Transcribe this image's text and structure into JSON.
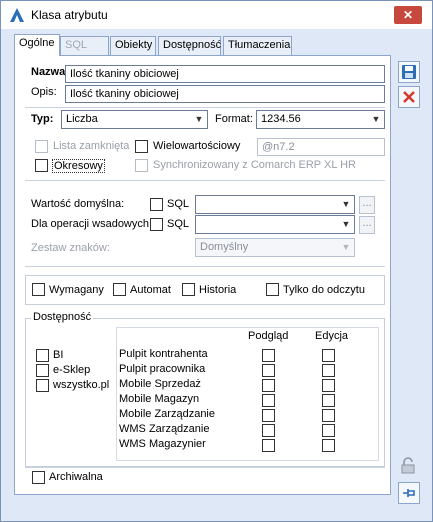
{
  "window": {
    "title": "Klasa atrybutu",
    "close_glyph": "✕"
  },
  "tabs": [
    {
      "label": "Ogólne",
      "active": true
    },
    {
      "label": "SQL",
      "disabled": true
    },
    {
      "label": "Obiekty"
    },
    {
      "label": "Dostępność"
    },
    {
      "label": "Tłumaczenia"
    }
  ],
  "form": {
    "name_label": "Nazwa:",
    "name_value": "Ilość tkaniny obiciowej",
    "desc_label": "Opis:",
    "desc_value": "Ilość tkaniny obiciowej",
    "type_label": "Typ:",
    "type_value": "Liczba",
    "format_label": "Format:",
    "format_value": "1234.56",
    "closed_list_label": "Lista zamknięta",
    "multivalue_label": "Wielowartościowy",
    "format_code": "@n7.2",
    "periodic_label": "Okresowy",
    "sync_label": "Synchronizowany z Comarch ERP XL HR",
    "default_label": "Wartość domyślna:",
    "batch_label": "Dla operacji wsadowych:",
    "sql_label": "SQL",
    "ellipsis": "...",
    "charset_label": "Zestaw znaków:",
    "charset_value": "Domyślny"
  },
  "flags": {
    "required": "Wymagany",
    "auto": "Automat",
    "history": "Historia",
    "readonly": "Tylko do odczytu"
  },
  "availability": {
    "title": "Dostępność",
    "apps": [
      "BI",
      "e-Sklep",
      "wszystko.pl"
    ],
    "col_preview": "Podgląd",
    "col_edit": "Edycja",
    "rows": [
      "Pulpit kontrahenta",
      "Pulpit pracownika",
      "Mobile Sprzedaż",
      "Mobile Magazyn",
      "Mobile Zarządzanie",
      "WMS Zarządzanie",
      "WMS Magazynier"
    ]
  },
  "archive_label": "Archiwalna",
  "colors": {
    "accent": "#2d6db5",
    "close": "#c7483c",
    "panel_border": "#8ea6c9"
  }
}
